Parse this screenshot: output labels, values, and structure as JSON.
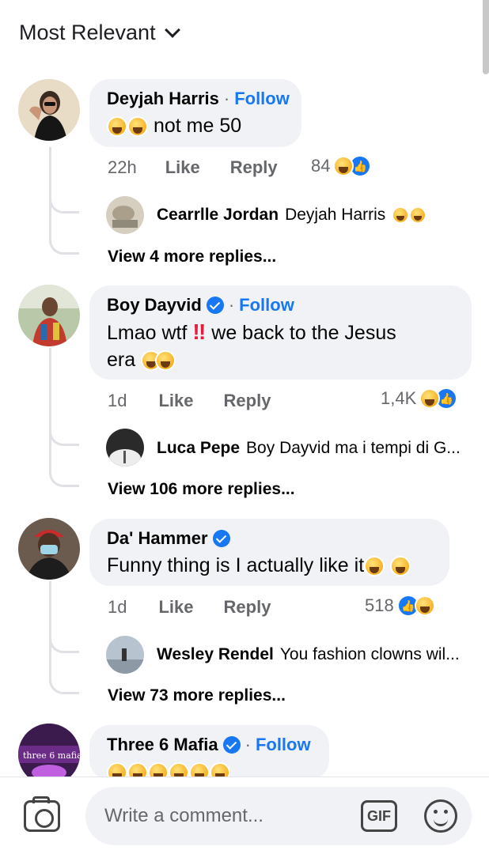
{
  "sort": {
    "label": "Most Relevant"
  },
  "comments": [
    {
      "author": "Deyjah Harris",
      "follow": "Follow",
      "verified": false,
      "text": "not me 50",
      "time": "22h",
      "like": "Like",
      "reply": "Reply",
      "reaction_count": "84",
      "reply_preview": {
        "author": "Cearrlle Jordan",
        "text": "Deyjah Harris"
      },
      "view_more": "View 4 more replies..."
    },
    {
      "author": "Boy Dayvid",
      "follow": "Follow",
      "verified": true,
      "text_1": "Lmao wtf",
      "text_2": "we back to the Jesus",
      "text_3": "era",
      "time": "1d",
      "like": "Like",
      "reply": "Reply",
      "reaction_count": "1,4K",
      "reply_preview": {
        "author": "Luca Pepe",
        "text": "Boy Dayvid ma i tempi di G..."
      },
      "view_more": "View 106 more replies..."
    },
    {
      "author": "Da' Hammer",
      "verified": true,
      "text": "Funny thing is I actually like it",
      "time": "1d",
      "like": "Like",
      "reply": "Reply",
      "reaction_count": "518",
      "reply_preview": {
        "author": "Wesley Rendel",
        "text": "You fashion clowns wil..."
      },
      "view_more": "View 73 more replies..."
    },
    {
      "author": "Three 6 Mafia",
      "follow": "Follow",
      "verified": true
    }
  ],
  "composer": {
    "placeholder": "Write a comment...",
    "gif_label": "GIF"
  },
  "icons": {
    "sort": "chevron-down-icon",
    "camera": "camera-icon",
    "emoji": "smiley-icon",
    "like_reaction": "thumbs-up-icon",
    "haha_reaction": "laughing-emoji-icon"
  },
  "colors": {
    "accent": "#1877f2",
    "bubble": "#f0f2f5",
    "muted": "#65676b"
  }
}
